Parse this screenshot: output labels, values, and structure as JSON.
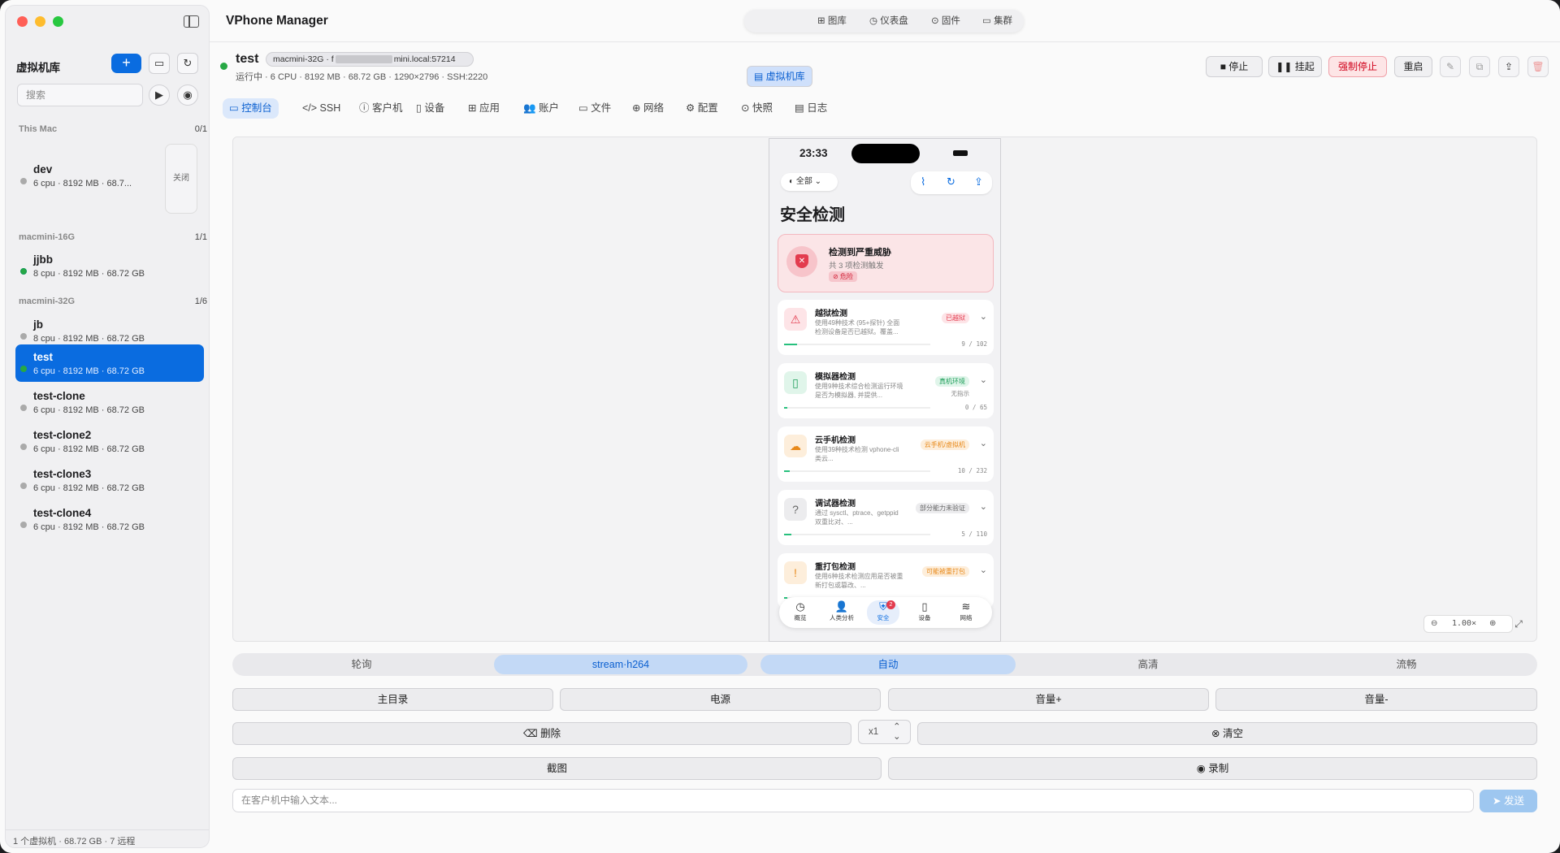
{
  "window": {
    "traffic": [
      "#ff5f57",
      "#febc2e",
      "#28c840"
    ]
  },
  "app": {
    "title": "VPhone Manager"
  },
  "topnav": [
    {
      "label": "虚拟机库",
      "icon": "library-icon"
    },
    {
      "label": "图库",
      "icon": "grid-icon"
    },
    {
      "label": "仪表盘",
      "icon": "gauge-icon"
    },
    {
      "label": "固件",
      "icon": "download-icon"
    },
    {
      "label": "集群",
      "icon": "monitor-icon"
    }
  ],
  "sidebar": {
    "title": "虚拟机库",
    "search_placeholder": "搜索",
    "close_label": "关闭",
    "groups": [
      {
        "name": "This Mac",
        "count": "0/1"
      },
      {
        "name": "macmini-16G",
        "count": "1/1"
      },
      {
        "name": "macmini-32G",
        "count": "1/6"
      }
    ],
    "vms": [
      {
        "name": "dev",
        "spec": "6 cpu · 8192 MB · 68.7...",
        "status": "stopped"
      },
      {
        "name": "jjbb",
        "spec": "8 cpu · 8192 MB · 68.72 GB",
        "status": "running"
      },
      {
        "name": "jb",
        "spec": "8 cpu · 8192 MB · 68.72 GB",
        "status": "stopped"
      },
      {
        "name": "test",
        "spec": "6 cpu · 8192 MB · 68.72 GB",
        "status": "running"
      },
      {
        "name": "test-clone",
        "spec": "6 cpu · 8192 MB · 68.72 GB",
        "status": "stopped"
      },
      {
        "name": "test-clone2",
        "spec": "6 cpu · 8192 MB · 68.72 GB",
        "status": "stopped"
      },
      {
        "name": "test-clone3",
        "spec": "6 cpu · 8192 MB · 68.72 GB",
        "status": "stopped"
      },
      {
        "name": "test-clone4",
        "spec": "6 cpu · 8192 MB · 68.72 GB",
        "status": "stopped"
      }
    ],
    "footer": "1 个虚拟机 · 68.72 GB · 7 远程"
  },
  "vm": {
    "name": "test",
    "host_prefix": "macmini-32G · f",
    "host_suffix": "mini.local:57214",
    "info": "运行中 · 6 CPU · 8192 MB · 68.72 GB · 1290×2796 · SSH:2220"
  },
  "actions": {
    "stop": "停止",
    "suspend": "挂起",
    "force_stop": "强制停止",
    "restart": "重启"
  },
  "tabs": [
    "控制台",
    "SSH",
    "客户机",
    "设备",
    "应用",
    "账户",
    "文件",
    "网络",
    "配置",
    "快照",
    "日志"
  ],
  "phone": {
    "time": "23:33",
    "filter": "全部",
    "title": "安全检测",
    "alert": {
      "title": "检测到严重威胁",
      "sub": "共 3 项检测触发",
      "badge": "危险"
    },
    "cards": [
      {
        "title": "越狱检测",
        "desc": "使用49种技术 (95+探针) 全面检测设备是否已越狱。覆盖...",
        "badge": "已越狱",
        "sub": "",
        "count": "9 / 102",
        "progress": 0.09,
        "color": "#e33b4e",
        "bg": "#fde4e7",
        "icon": "warning-icon",
        "glyph": "⚠"
      },
      {
        "title": "模拟器检测",
        "desc": "使用9种技术综合检测运行环境是否为模拟器, 并提供...",
        "badge": "真机环境",
        "sub": "无指示",
        "count": "0 / 65",
        "progress": 0.0,
        "color": "#1e9e5a",
        "bg": "#e0f5ea",
        "icon": "phone-icon",
        "glyph": "▯"
      },
      {
        "title": "云手机检测",
        "desc": "使用39种技术检测 vphone-cli 类云...",
        "badge": "云手机/虚拟机",
        "sub": "",
        "count": "10 / 232",
        "progress": 0.04,
        "color": "#e8891a",
        "bg": "#fdeedb",
        "icon": "cloud-icon",
        "glyph": "☁"
      },
      {
        "title": "调试器检测",
        "desc": "通过 sysctl、ptrace、getppid 双重比对、...",
        "badge": "部分能力未验证",
        "sub": "",
        "count": "5 / 110",
        "progress": 0.05,
        "color": "#666666",
        "bg": "#ececee",
        "icon": "question-icon",
        "glyph": "?"
      },
      {
        "title": "重打包检测",
        "desc": "使用6种技术检测应用是否被重新打包或篡改、...",
        "badge": "可能被重打包",
        "sub": "",
        "count": "",
        "progress": 0,
        "color": "#e8891a",
        "bg": "#fdeedb",
        "icon": "alert-icon",
        "glyph": "!"
      }
    ],
    "tabbar": [
      {
        "label": "概览",
        "glyph": "◷",
        "icon": "gauge-icon"
      },
      {
        "label": "人类分析",
        "glyph": "👤",
        "icon": "person-icon"
      },
      {
        "label": "安全",
        "glyph": "⛨",
        "icon": "shield-icon",
        "badge": "2"
      },
      {
        "label": "设备",
        "glyph": "▯",
        "icon": "device-icon"
      },
      {
        "label": "网络",
        "glyph": "≋",
        "icon": "wifi-icon"
      }
    ]
  },
  "zoom": "1.00×",
  "stream": [
    "轮询",
    "stream·h264",
    "自动",
    "高清",
    "流畅"
  ],
  "controls": {
    "home": "主目录",
    "power": "电源",
    "vol_up": "音量+",
    "vol_down": "音量-",
    "delete": "删除",
    "multiplier": "x1",
    "clear": "清空",
    "screenshot": "截图",
    "record": "录制"
  },
  "input": {
    "placeholder": "在客户机中输入文本...",
    "send": "发送"
  }
}
